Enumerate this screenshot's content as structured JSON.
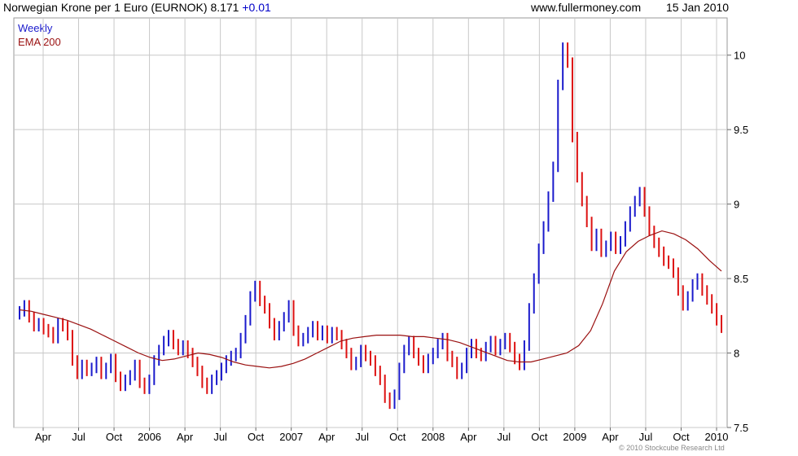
{
  "header": {
    "instrument": "Norwegian Krone per 1 Euro (EURNOK)",
    "last": "8.171",
    "change": "+0.01",
    "site": "www.fullermoney.com",
    "date": "15 Jan 2010"
  },
  "legend": {
    "weekly": "Weekly",
    "ema": "EMA 200"
  },
  "copyright": "© 2010 Stockcube Research Ltd",
  "colors": {
    "up": "#1a1acc",
    "down": "#dd1111",
    "ema": "#9a1010",
    "grid": "#c8c8c8"
  },
  "chart_data": {
    "type": "candlestick",
    "ylim": [
      7.5,
      10.25
    ],
    "y_ticks": [
      "7.5",
      "8",
      "8.5",
      "9",
      "9.5",
      "10"
    ],
    "x_tick_labels": [
      "Apr",
      "Jul",
      "Oct",
      "2006",
      "Apr",
      "Jul",
      "Oct",
      "2007",
      "Apr",
      "Jul",
      "Oct",
      "2008",
      "Apr",
      "Jul",
      "Oct",
      "2009",
      "Apr",
      "Jul",
      "Oct",
      "2010"
    ],
    "x_range": [
      "2005-01",
      "2010-01"
    ],
    "legend_placement": "top-left",
    "grid": true,
    "series": [
      {
        "name": "Weekly",
        "close": [
          8.28,
          8.32,
          8.24,
          8.18,
          8.2,
          8.16,
          8.14,
          8.1,
          8.2,
          8.18,
          8.12,
          7.95,
          7.86,
          7.92,
          7.88,
          7.9,
          7.94,
          7.86,
          7.9,
          7.96,
          7.84,
          7.78,
          7.82,
          7.85,
          7.92,
          7.8,
          7.76,
          7.82,
          7.95,
          8.02,
          8.08,
          8.12,
          8.06,
          8.02,
          8.05,
          8.0,
          7.94,
          7.88,
          7.8,
          7.76,
          7.82,
          7.85,
          7.9,
          7.95,
          7.98,
          8.0,
          8.1,
          8.22,
          8.38,
          8.45,
          8.35,
          8.3,
          8.2,
          8.12,
          8.18,
          8.24,
          8.32,
          8.15,
          8.08,
          8.1,
          8.14,
          8.18,
          8.12,
          8.15,
          8.1,
          8.14,
          8.12,
          8.06,
          8.0,
          7.92,
          7.94,
          8.02,
          7.98,
          7.95,
          7.88,
          7.82,
          7.7,
          7.66,
          7.72,
          7.9,
          8.02,
          8.08,
          8.0,
          7.95,
          7.9,
          7.96,
          8.0,
          8.06,
          8.1,
          7.98,
          7.94,
          7.86,
          7.9,
          8.0,
          8.06,
          8.0,
          7.98,
          8.04,
          8.08,
          8.02,
          8.06,
          8.1,
          8.04,
          7.96,
          7.92,
          8.05,
          8.3,
          8.5,
          8.7,
          8.85,
          9.05,
          9.25,
          9.8,
          10.05,
          9.95,
          9.45,
          9.18,
          9.02,
          8.88,
          8.72,
          8.8,
          8.68,
          8.72,
          8.78,
          8.7,
          8.75,
          8.85,
          8.95,
          9.02,
          9.08,
          8.95,
          8.82,
          8.74,
          8.68,
          8.62,
          8.6,
          8.54,
          8.42,
          8.32,
          8.38,
          8.46,
          8.5,
          8.42,
          8.36,
          8.3,
          8.22,
          8.17
        ]
      },
      {
        "name": "EMA 200",
        "values": [
          8.29,
          8.28,
          8.26,
          8.24,
          8.22,
          8.19,
          8.16,
          8.12,
          8.08,
          8.04,
          8.0,
          7.97,
          7.95,
          7.96,
          7.98,
          8.0,
          7.99,
          7.97,
          7.94,
          7.92,
          7.91,
          7.9,
          7.91,
          7.93,
          7.96,
          8.0,
          8.04,
          8.08,
          8.1,
          8.11,
          8.12,
          8.12,
          8.12,
          8.11,
          8.11,
          8.1,
          8.09,
          8.07,
          8.04,
          8.01,
          7.98,
          7.95,
          7.94,
          7.94,
          7.96,
          7.98,
          8.0,
          8.05,
          8.15,
          8.33,
          8.55,
          8.68,
          8.75,
          8.79,
          8.82,
          8.8,
          8.76,
          8.7,
          8.62,
          8.55
        ]
      }
    ]
  }
}
